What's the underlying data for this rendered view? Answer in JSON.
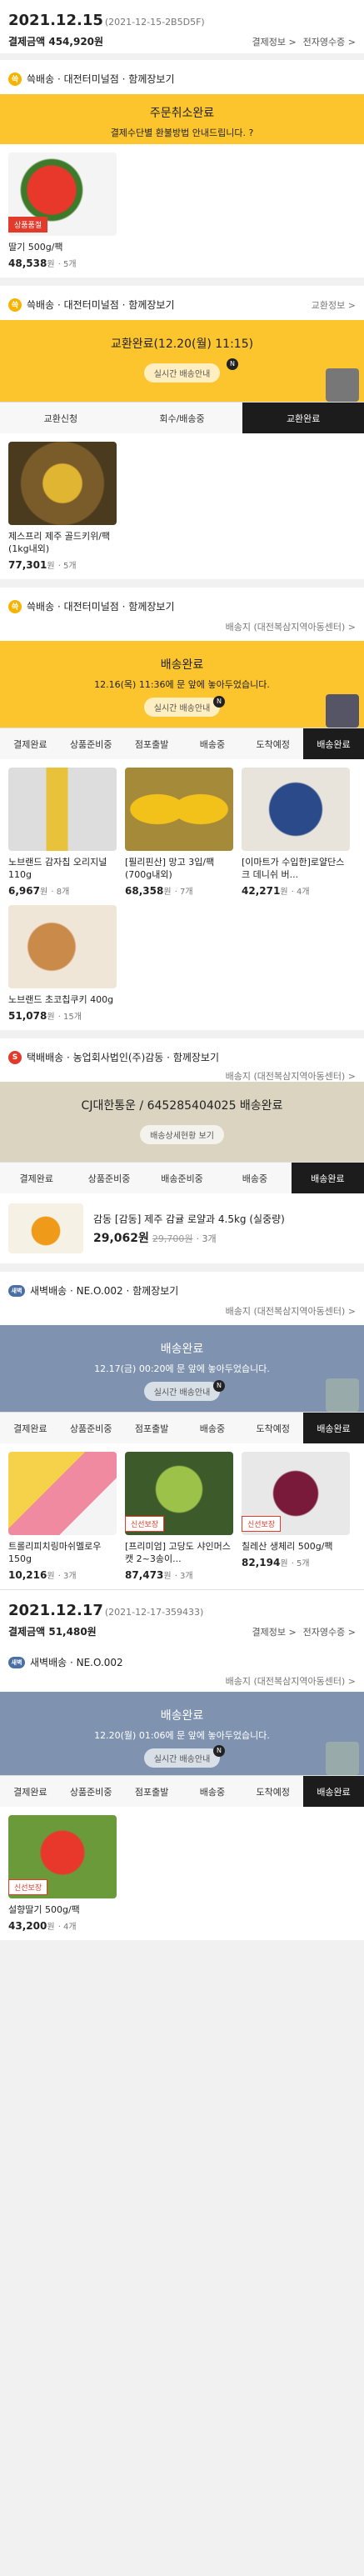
{
  "orders": [
    {
      "date": "2021.12.15",
      "code": "(2021-12-15-2B5D5F)",
      "total_label": "결제금액",
      "total": "454,920원",
      "links": [
        "결제정보 >",
        "전자영수증 >"
      ]
    },
    {
      "date": "2021.12.17",
      "code": "(2021-12-17-359433)",
      "total_label": "결제금액",
      "total": "51,480원",
      "links": [
        "결제정보 >",
        "전자영수증 >"
      ]
    }
  ],
  "shipments": [
    {
      "type": "쓱배송",
      "store": "대전터미널점",
      "extra": "함께장보기",
      "right": "",
      "banner_title": "주문취소완료",
      "banner_sub": "결제수단별 환불방법 안내드립니다. ?",
      "banner_btn": "",
      "steps": [],
      "products": [
        {
          "name": "딸기 500g/팩",
          "price": "48,538",
          "unit": "원",
          "qty": "· 5개",
          "tag": "상품품절"
        }
      ]
    },
    {
      "type": "쓱배송",
      "store": "대전터미널점",
      "extra": "함께장보기",
      "right": "교환정보 >",
      "banner_title": "교환완료(12.20(월) 11:15)",
      "banner_sub": "",
      "banner_btn": "실시간 배송안내",
      "steps": [
        "교환신청",
        "회수/배송중",
        "교환완료"
      ],
      "products": [
        {
          "name": "제스프리 제주 골드키위/팩 (1kg내외)",
          "price": "77,301",
          "unit": "원",
          "qty": "· 5개",
          "tag": ""
        }
      ]
    },
    {
      "type": "쓱배송",
      "store": "대전터미널점",
      "extra": "함께장보기",
      "right": "배송지 (대전복삼지역아동센터) >",
      "banner_title": "배송완료",
      "banner_sub": "12.16(목) 11:36에 문 앞에 놓아두었습니다.",
      "banner_btn": "실시간 배송안내",
      "steps": [
        "결제완료",
        "상품준비중",
        "점포출발",
        "배송중",
        "도착예정",
        "배송완료"
      ],
      "products": [
        {
          "name": "노브랜드 감자칩 오리지널 110g",
          "price": "6,967",
          "unit": "원",
          "qty": "· 8개",
          "tag": ""
        },
        {
          "name": "[필리핀산] 망고 3입/팩(700g내외)",
          "price": "68,358",
          "unit": "원",
          "qty": "· 7개",
          "tag": ""
        },
        {
          "name": "[이마트가 수입한]로얄단스크 데니쉬 버...",
          "price": "42,271",
          "unit": "원",
          "qty": "· 4개",
          "tag": ""
        },
        {
          "name": "노브랜드 초코칩쿠키 400g",
          "price": "51,078",
          "unit": "원",
          "qty": "· 15개",
          "tag": ""
        }
      ]
    },
    {
      "type": "택배배송",
      "store": "농업회사법인(주)감동",
      "extra": "함께장보기",
      "right": "배송지 (대전복삼지역아동센터) >",
      "banner_title": "CJ대한통운 / 645285404025 배송완료",
      "banner_sub": "",
      "banner_btn": "배송상세현황 보기",
      "steps": [
        "결제완료",
        "상품준비중",
        "배송준비중",
        "배송중",
        "배송완료"
      ],
      "products": [
        {
          "name": "감동 [감동] 제주 감귤 로얄과 4.5kg (실중량)",
          "price": "29,062",
          "unit": "원",
          "orig": "29,700원",
          "qty": "· 3개",
          "tag": ""
        }
      ]
    },
    {
      "type": "새벽배송",
      "store": "NE.O.002",
      "extra": "함께장보기",
      "right": "배송지 (대전복삼지역아동센터) >",
      "banner_title": "배송완료",
      "banner_sub": "12.17(금) 00:20에 문 앞에 놓아두었습니다.",
      "banner_btn": "실시간 배송안내",
      "steps": [
        "결제완료",
        "상품준비중",
        "점포출발",
        "배송중",
        "도착예정",
        "배송완료"
      ],
      "products": [
        {
          "name": "트롤리피치링마쉬멜로우150g",
          "price": "10,216",
          "unit": "원",
          "qty": "· 3개",
          "tag": ""
        },
        {
          "name": "[프리미엄] 고당도 샤인머스캣 2~3송이...",
          "price": "87,473",
          "unit": "원",
          "qty": "· 3개",
          "tag": "신선보장"
        },
        {
          "name": "칠레산 생체리 500g/팩",
          "price": "82,194",
          "unit": "원",
          "qty": "· 5개",
          "tag": "신선보장"
        }
      ]
    },
    {
      "type": "새벽배송",
      "store": "NE.O.002",
      "extra": "",
      "right": "배송지 (대전복삼지역아동센터) >",
      "banner_title": "배송완료",
      "banner_sub": "12.20(월) 01:06에 문 앞에 놓아두었습니다.",
      "banner_btn": "실시간 배송안내",
      "steps": [
        "결제완료",
        "상품준비중",
        "점포출발",
        "배송중",
        "도착예정",
        "배송완료"
      ],
      "products": [
        {
          "name": "설향딸기 500g/팩",
          "price": "43,200",
          "unit": "원",
          "qty": "· 4개",
          "tag": "신선보장"
        }
      ]
    }
  ]
}
